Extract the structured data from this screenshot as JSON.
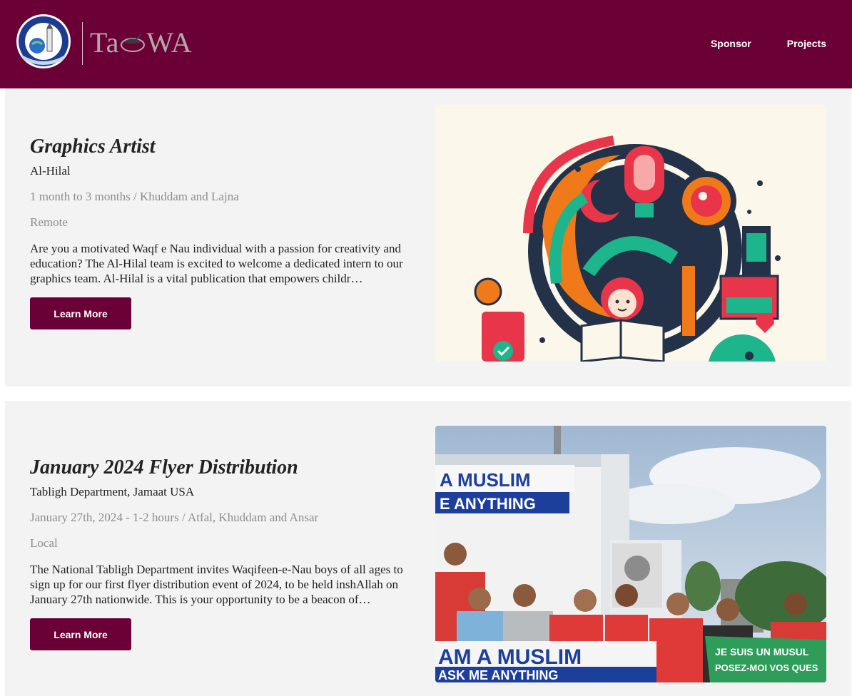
{
  "header": {
    "brand_text": "TaQWA",
    "brand_prefix": "Ta",
    "brand_suffix": "WA",
    "nav": [
      "Sponsor",
      "Projects"
    ],
    "brand_color": "#6b0036"
  },
  "projects": [
    {
      "title": "Graphics Artist",
      "org": "Al-Hilal",
      "meta": "1 month to 3 months / Khuddam and Lajna",
      "location": "Remote",
      "description": "Are you a motivated Waqf e Nau individual with a passion for creativity and education? The Al-Hilal team is excited to welcome a dedicated intern to our graphics team. Al-Hilal is a vital publication that empowers childr…",
      "button": "Learn More",
      "image": "graphics-illustration"
    },
    {
      "title": "January 2024 Flyer Distribution",
      "org": "Tabligh Department, Jamaat USA",
      "meta": "January 27th, 2024 - 1-2 hours / Atfal, Khuddam and Ansar",
      "location": "Local",
      "description": "The National Tabligh Department invites Waqifeen-e-Nau boys of all ages to sign up for our first flyer distribution event of 2024, to be held inshAllah on January 27th nationwide. This is your opportunity to be a beacon of…",
      "button": "Learn More",
      "image": "group-photo",
      "photo_signs": {
        "truck_line1": "A MUSLIM",
        "truck_line2": "E ANYTHING",
        "banner_line1": "AM A MUSLIM",
        "banner_line2": "ASK ME ANYTHING",
        "green_line1": "JE SUIS UN MUSUL",
        "green_line2": "POSEZ-MOI VOS QUES"
      }
    }
  ]
}
